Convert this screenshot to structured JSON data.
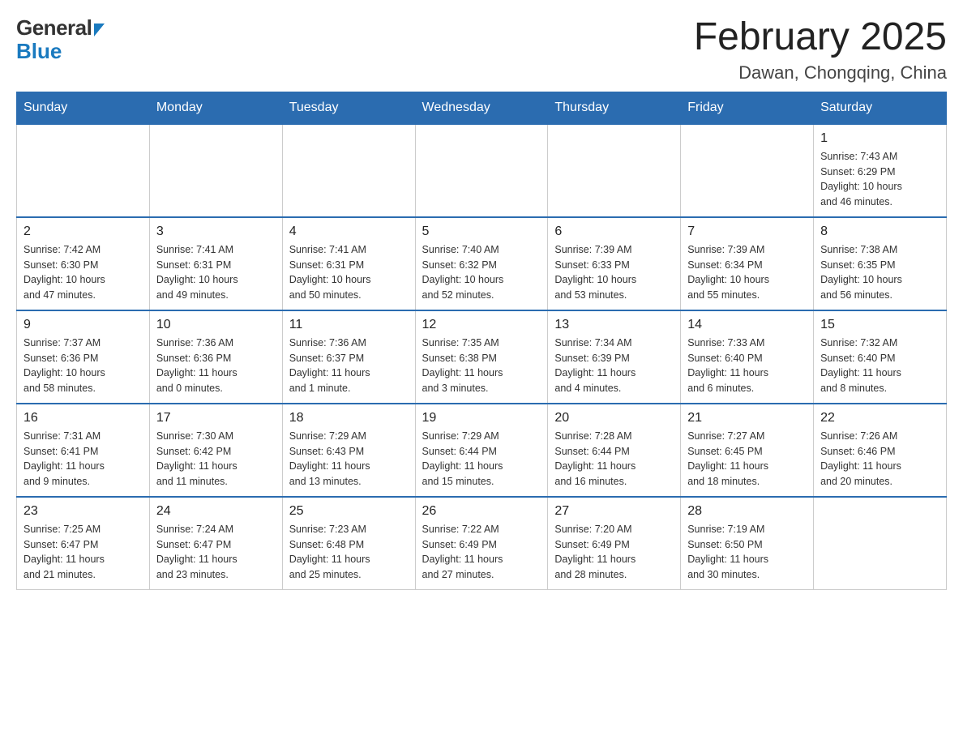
{
  "logo": {
    "general": "General",
    "blue": "Blue",
    "arrowColor": "#1a7abf"
  },
  "header": {
    "month": "February 2025",
    "location": "Dawan, Chongqing, China"
  },
  "days_of_week": [
    "Sunday",
    "Monday",
    "Tuesday",
    "Wednesday",
    "Thursday",
    "Friday",
    "Saturday"
  ],
  "weeks": [
    [
      {
        "day": "",
        "info": ""
      },
      {
        "day": "",
        "info": ""
      },
      {
        "day": "",
        "info": ""
      },
      {
        "day": "",
        "info": ""
      },
      {
        "day": "",
        "info": ""
      },
      {
        "day": "",
        "info": ""
      },
      {
        "day": "1",
        "info": "Sunrise: 7:43 AM\nSunset: 6:29 PM\nDaylight: 10 hours\nand 46 minutes."
      }
    ],
    [
      {
        "day": "2",
        "info": "Sunrise: 7:42 AM\nSunset: 6:30 PM\nDaylight: 10 hours\nand 47 minutes."
      },
      {
        "day": "3",
        "info": "Sunrise: 7:41 AM\nSunset: 6:31 PM\nDaylight: 10 hours\nand 49 minutes."
      },
      {
        "day": "4",
        "info": "Sunrise: 7:41 AM\nSunset: 6:31 PM\nDaylight: 10 hours\nand 50 minutes."
      },
      {
        "day": "5",
        "info": "Sunrise: 7:40 AM\nSunset: 6:32 PM\nDaylight: 10 hours\nand 52 minutes."
      },
      {
        "day": "6",
        "info": "Sunrise: 7:39 AM\nSunset: 6:33 PM\nDaylight: 10 hours\nand 53 minutes."
      },
      {
        "day": "7",
        "info": "Sunrise: 7:39 AM\nSunset: 6:34 PM\nDaylight: 10 hours\nand 55 minutes."
      },
      {
        "day": "8",
        "info": "Sunrise: 7:38 AM\nSunset: 6:35 PM\nDaylight: 10 hours\nand 56 minutes."
      }
    ],
    [
      {
        "day": "9",
        "info": "Sunrise: 7:37 AM\nSunset: 6:36 PM\nDaylight: 10 hours\nand 58 minutes."
      },
      {
        "day": "10",
        "info": "Sunrise: 7:36 AM\nSunset: 6:36 PM\nDaylight: 11 hours\nand 0 minutes."
      },
      {
        "day": "11",
        "info": "Sunrise: 7:36 AM\nSunset: 6:37 PM\nDaylight: 11 hours\nand 1 minute."
      },
      {
        "day": "12",
        "info": "Sunrise: 7:35 AM\nSunset: 6:38 PM\nDaylight: 11 hours\nand 3 minutes."
      },
      {
        "day": "13",
        "info": "Sunrise: 7:34 AM\nSunset: 6:39 PM\nDaylight: 11 hours\nand 4 minutes."
      },
      {
        "day": "14",
        "info": "Sunrise: 7:33 AM\nSunset: 6:40 PM\nDaylight: 11 hours\nand 6 minutes."
      },
      {
        "day": "15",
        "info": "Sunrise: 7:32 AM\nSunset: 6:40 PM\nDaylight: 11 hours\nand 8 minutes."
      }
    ],
    [
      {
        "day": "16",
        "info": "Sunrise: 7:31 AM\nSunset: 6:41 PM\nDaylight: 11 hours\nand 9 minutes."
      },
      {
        "day": "17",
        "info": "Sunrise: 7:30 AM\nSunset: 6:42 PM\nDaylight: 11 hours\nand 11 minutes."
      },
      {
        "day": "18",
        "info": "Sunrise: 7:29 AM\nSunset: 6:43 PM\nDaylight: 11 hours\nand 13 minutes."
      },
      {
        "day": "19",
        "info": "Sunrise: 7:29 AM\nSunset: 6:44 PM\nDaylight: 11 hours\nand 15 minutes."
      },
      {
        "day": "20",
        "info": "Sunrise: 7:28 AM\nSunset: 6:44 PM\nDaylight: 11 hours\nand 16 minutes."
      },
      {
        "day": "21",
        "info": "Sunrise: 7:27 AM\nSunset: 6:45 PM\nDaylight: 11 hours\nand 18 minutes."
      },
      {
        "day": "22",
        "info": "Sunrise: 7:26 AM\nSunset: 6:46 PM\nDaylight: 11 hours\nand 20 minutes."
      }
    ],
    [
      {
        "day": "23",
        "info": "Sunrise: 7:25 AM\nSunset: 6:47 PM\nDaylight: 11 hours\nand 21 minutes."
      },
      {
        "day": "24",
        "info": "Sunrise: 7:24 AM\nSunset: 6:47 PM\nDaylight: 11 hours\nand 23 minutes."
      },
      {
        "day": "25",
        "info": "Sunrise: 7:23 AM\nSunset: 6:48 PM\nDaylight: 11 hours\nand 25 minutes."
      },
      {
        "day": "26",
        "info": "Sunrise: 7:22 AM\nSunset: 6:49 PM\nDaylight: 11 hours\nand 27 minutes."
      },
      {
        "day": "27",
        "info": "Sunrise: 7:20 AM\nSunset: 6:49 PM\nDaylight: 11 hours\nand 28 minutes."
      },
      {
        "day": "28",
        "info": "Sunrise: 7:19 AM\nSunset: 6:50 PM\nDaylight: 11 hours\nand 30 minutes."
      },
      {
        "day": "",
        "info": ""
      }
    ]
  ]
}
